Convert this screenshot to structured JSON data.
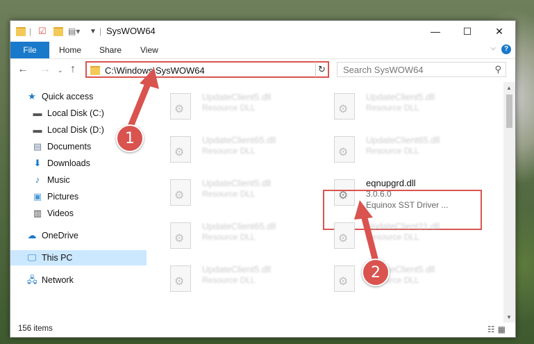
{
  "window": {
    "title": "SysWOW64",
    "controls": {
      "minimize": "—",
      "maximize": "☐",
      "close": "✕"
    }
  },
  "ribbon": {
    "tabs": [
      "File",
      "Home",
      "Share",
      "View"
    ]
  },
  "address": {
    "path": "C:\\Windows\\SysWOW64",
    "search_placeholder": "Search SysWOW64"
  },
  "nav": {
    "items": [
      {
        "label": "Quick access",
        "icon": "star-icon"
      },
      {
        "label": "Local Disk (C:)",
        "icon": "drive-icon"
      },
      {
        "label": "Local Disk (D:)",
        "icon": "drive-icon"
      },
      {
        "label": "Documents",
        "icon": "documents-icon"
      },
      {
        "label": "Downloads",
        "icon": "download-icon"
      },
      {
        "label": "Music",
        "icon": "music-icon"
      },
      {
        "label": "Pictures",
        "icon": "pictures-icon"
      },
      {
        "label": "Videos",
        "icon": "videos-icon"
      },
      {
        "label": "OneDrive",
        "icon": "cloud-icon"
      },
      {
        "label": "This PC",
        "icon": "computer-icon"
      },
      {
        "label": "Network",
        "icon": "network-icon"
      }
    ]
  },
  "files": [
    {
      "name": "UpdateClient5.dll",
      "type": "Resource DLL"
    },
    {
      "name": "UpdateClient5.dll",
      "type": "Resource DLL"
    },
    {
      "name": "UpdateClient65.dll",
      "type": "Resource DLL"
    },
    {
      "name": "UpdateClient65.dll",
      "type": "Resource DLL"
    },
    {
      "name": "UpdateClient5.dll",
      "type": "Resource DLL"
    },
    {
      "name": "eqnupgrd.dll",
      "type": "3.0.6.0",
      "description": "Equinox SST Driver ..."
    },
    {
      "name": "UpdateClient65.dll",
      "type": "Resource DLL"
    },
    {
      "name": "UpdateClient21.dll",
      "type": "Resource DLL"
    },
    {
      "name": "UpdateClient5.dll",
      "type": "Resource DLL"
    },
    {
      "name": "UpdateClient5.dll",
      "type": "Resource DLL"
    }
  ],
  "status": {
    "items": "156 items"
  },
  "annotations": {
    "step1": "1",
    "step2": "2"
  },
  "colors": {
    "accent": "#1979ca",
    "highlight": "#d9534f",
    "selection": "#cce8ff"
  }
}
